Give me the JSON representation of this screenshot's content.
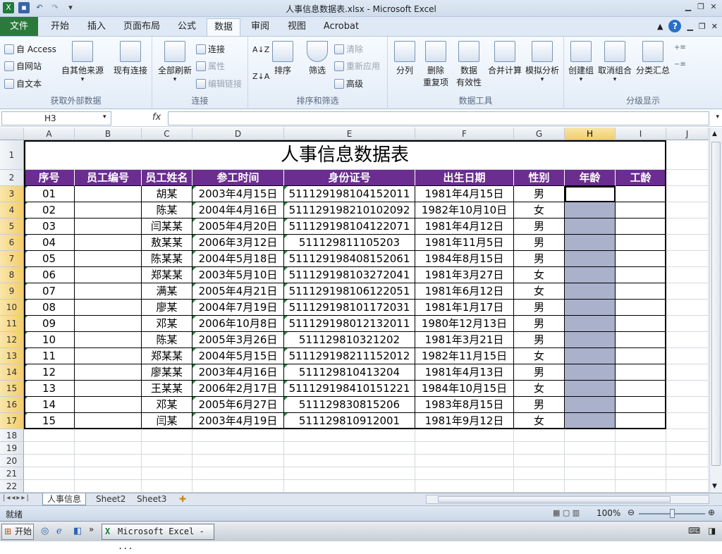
{
  "window": {
    "title": "人事信息数据表.xlsx - Microsoft Excel"
  },
  "tabs": [
    "文件",
    "开始",
    "插入",
    "页面布局",
    "公式",
    "数据",
    "审阅",
    "视图",
    "Acrobat"
  ],
  "ribbon": {
    "get_external": {
      "label": "获取外部数据",
      "access": "自 Access",
      "web": "自网站",
      "text": "自文本",
      "other": "自其他来源",
      "existing": "现有连接"
    },
    "connections": {
      "label": "连接",
      "refresh_all": "全部刷新",
      "connections": "连接",
      "properties": "属性",
      "edit_links": "编辑链接"
    },
    "sort_filter": {
      "label": "排序和筛选",
      "sort": "排序",
      "filter": "筛选",
      "clear": "清除",
      "reapply": "重新应用",
      "advanced": "高级"
    },
    "data_tools": {
      "label": "数据工具",
      "split": "分列",
      "remove_dup_1": "删除",
      "remove_dup_2": "重复项",
      "validation_1": "数据",
      "validation_2": "有效性",
      "consolidate": "合并计算",
      "what_if": "模拟分析"
    },
    "outline": {
      "label": "分级显示",
      "group": "创建组",
      "ungroup": "取消组合",
      "subtotal": "分类汇总"
    }
  },
  "formula_bar": {
    "name_box": "H3",
    "fx": "fx",
    "value": ""
  },
  "columns": [
    "A",
    "B",
    "C",
    "D",
    "E",
    "F",
    "G",
    "H",
    "I",
    "J"
  ],
  "rows": [
    "1",
    "2",
    "3",
    "4",
    "5",
    "6",
    "7",
    "8",
    "9",
    "10",
    "11",
    "12",
    "13",
    "14",
    "15",
    "16",
    "17",
    "18",
    "19",
    "20",
    "21",
    "22"
  ],
  "table": {
    "title": "人事信息数据表",
    "headers": [
      "序号",
      "员工编号",
      "员工姓名",
      "参工时间",
      "身份证号",
      "出生日期",
      "性别",
      "年龄",
      "工龄"
    ],
    "rows": [
      [
        "01",
        "",
        "胡某",
        "2003年4月15日",
        "511129198104152011",
        "1981年4月15日",
        "男",
        "",
        ""
      ],
      [
        "02",
        "",
        "陈某",
        "2004年4月16日",
        "511129198210102092",
        "1982年10月10日",
        "女",
        "",
        ""
      ],
      [
        "03",
        "",
        "闫某某",
        "2005年4月20日",
        "511129198104122071",
        "1981年4月12日",
        "男",
        "",
        ""
      ],
      [
        "04",
        "",
        "敖某某",
        "2006年3月12日",
        "511129811105203",
        "1981年11月5日",
        "男",
        "",
        ""
      ],
      [
        "05",
        "",
        "陈某某",
        "2004年5月18日",
        "511129198408152061",
        "1984年8月15日",
        "男",
        "",
        ""
      ],
      [
        "06",
        "",
        "郑某某",
        "2003年5月10日",
        "511129198103272041",
        "1981年3月27日",
        "女",
        "",
        ""
      ],
      [
        "07",
        "",
        "满某",
        "2005年4月21日",
        "511129198106122051",
        "1981年6月12日",
        "女",
        "",
        ""
      ],
      [
        "08",
        "",
        "廖某",
        "2004年7月19日",
        "511129198101172031",
        "1981年1月17日",
        "男",
        "",
        ""
      ],
      [
        "09",
        "",
        "邓某",
        "2006年10月8日",
        "511129198012132011",
        "1980年12月13日",
        "男",
        "",
        ""
      ],
      [
        "10",
        "",
        "陈某",
        "2005年3月26日",
        "511129810321202",
        "1981年3月21日",
        "男",
        "",
        ""
      ],
      [
        "11",
        "",
        "郑某某",
        "2004年5月15日",
        "511129198211152012",
        "1982年11月15日",
        "女",
        "",
        ""
      ],
      [
        "12",
        "",
        "廖某某",
        "2003年4月16日",
        "511129810413204",
        "1981年4月13日",
        "男",
        "",
        ""
      ],
      [
        "13",
        "",
        "王某某",
        "2006年2月17日",
        "511129198410151221",
        "1984年10月15日",
        "女",
        "",
        ""
      ],
      [
        "14",
        "",
        "邓某",
        "2005年6月27日",
        "511129830815206",
        "1983年8月15日",
        "男",
        "",
        ""
      ],
      [
        "15",
        "",
        "闫某",
        "2003年4月19日",
        "511129810912001",
        "1981年9月12日",
        "女",
        "",
        ""
      ]
    ]
  },
  "sheet_tabs": [
    "人事信息",
    "Sheet2",
    "Sheet3"
  ],
  "status": {
    "ready": "就绪",
    "zoom": "100%"
  },
  "taskbar": {
    "start": "开始",
    "app": "Microsoft Excel - ..."
  },
  "colors": {
    "header_purple": "#6b2d8f",
    "selection": "#a9b1cb",
    "file_tab": "#2b7a3c"
  }
}
